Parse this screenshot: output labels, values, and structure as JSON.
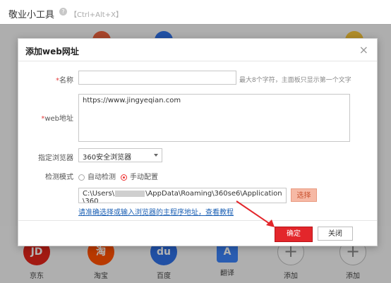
{
  "window": {
    "title": "敬业小工具",
    "help_icon": "?",
    "hotkey": "【Ctrl+Alt+X】"
  },
  "dialog": {
    "title": "添加web网址",
    "close_icon": "×",
    "name_label": "名称",
    "name_value": "",
    "name_hint": "最大8个字符，主面板只显示第一个文字",
    "url_label": "web地址",
    "url_value": "https://www.jingyeqian.com",
    "browser_label": "指定浏览器",
    "browser_value": "360安全浏览器",
    "mode_label": "检测模式",
    "mode_auto": "自动检测",
    "mode_manual": "手动配置",
    "path_prefix": "C:\\Users\\",
    "path_suffix": "\\AppData\\Roaming\\360se6\\Application",
    "path_line2": "\\360",
    "pick_button": "选择",
    "help_link": "请准确选择或输入浏览器的主程序地址，查看教程",
    "ok_button": "确定",
    "cancel_button": "关闭"
  },
  "apps": [
    {
      "label": "京东",
      "glyph": "JD"
    },
    {
      "label": "淘宝",
      "glyph": "淘"
    },
    {
      "label": "百度",
      "glyph": "du"
    },
    {
      "label": "翻译",
      "glyph": "A"
    },
    {
      "label": "添加",
      "glyph": "+"
    },
    {
      "label": "添加",
      "glyph": "+"
    }
  ],
  "colors": {
    "accent_red": "#e3262b",
    "jd_red": "#e1251b",
    "taobao_orange": "#ff5000",
    "baidu_blue": "#2f6fe4",
    "translate_blue": "#3b82f6"
  }
}
